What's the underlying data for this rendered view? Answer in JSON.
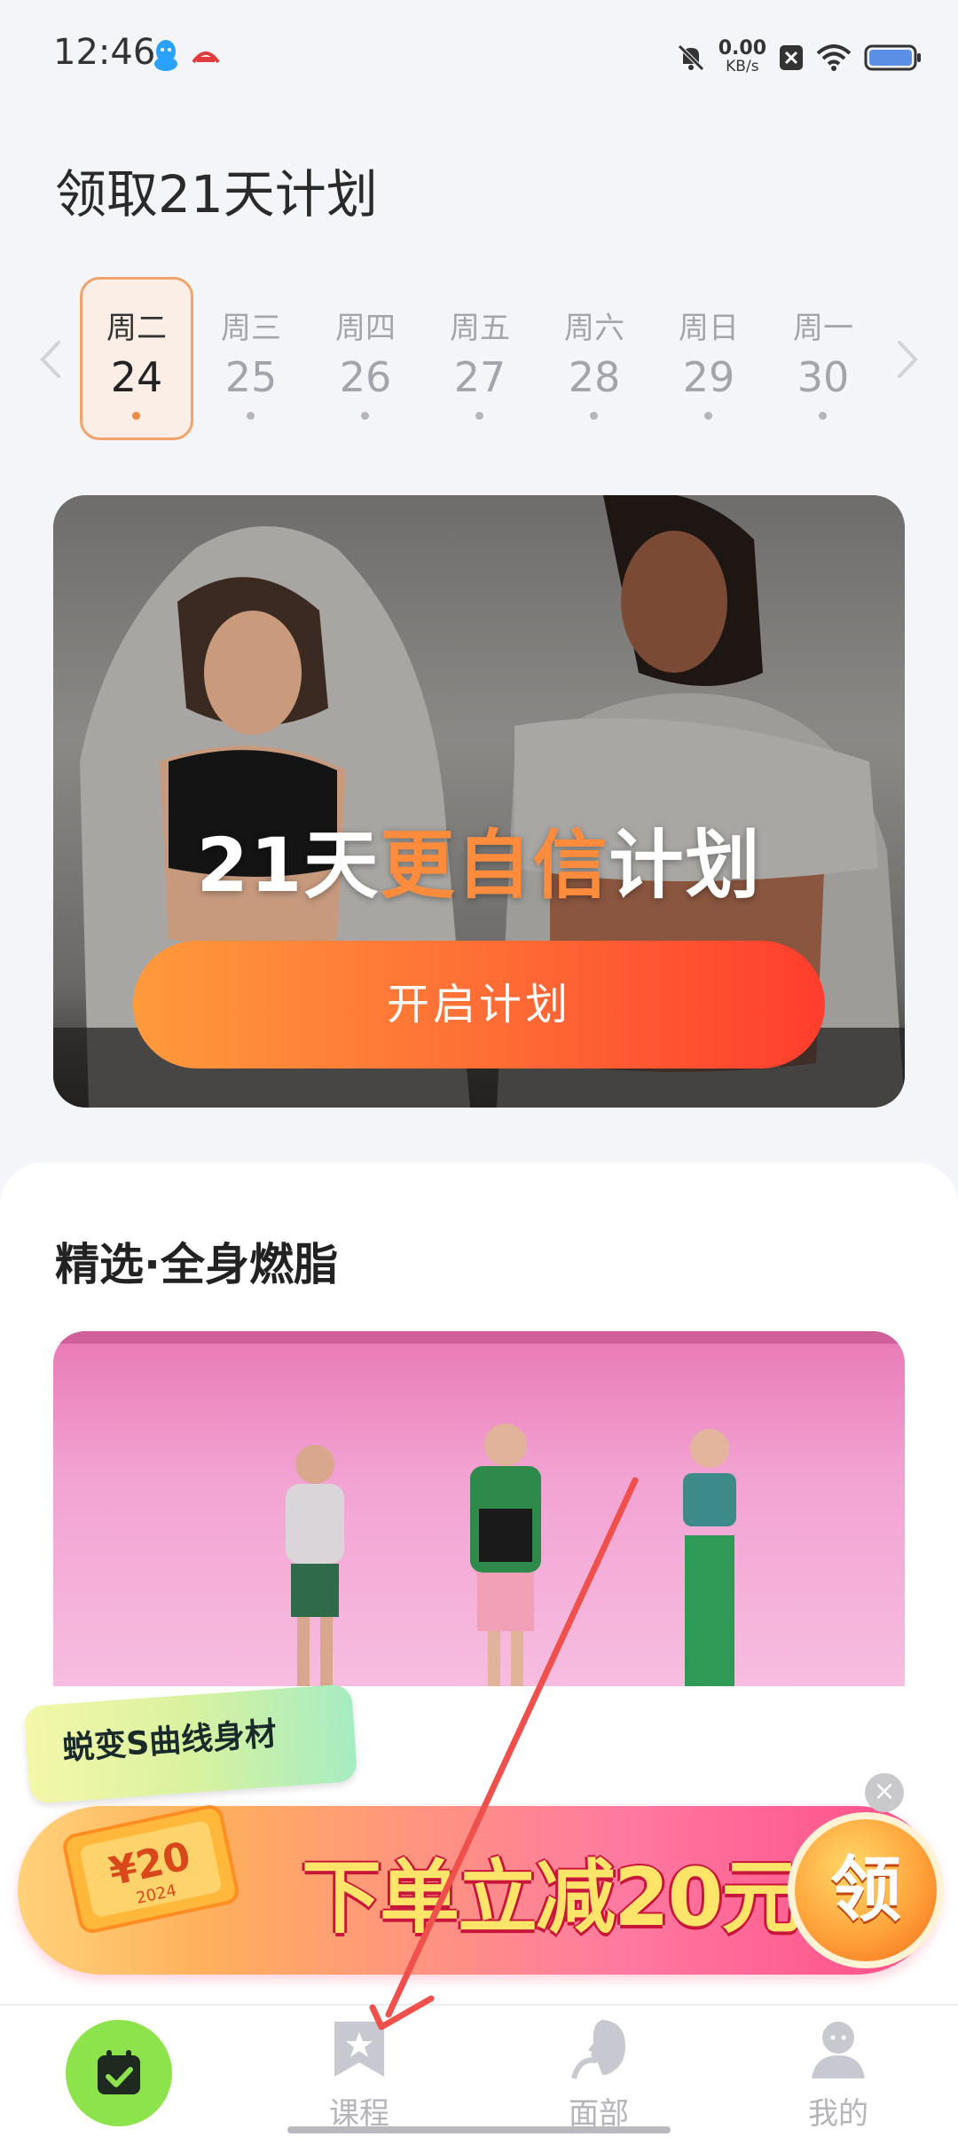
{
  "status_bar": {
    "time": "12:46",
    "net_speed_value": "0.00",
    "net_speed_unit": "KB/s",
    "icons": [
      "qq-icon",
      "app-badge-icon",
      "mute-icon",
      "close-box-icon",
      "wifi-icon",
      "battery-icon"
    ]
  },
  "page": {
    "title": "领取21天计划"
  },
  "days": [
    {
      "weekday": "周二",
      "date": "24",
      "active": true
    },
    {
      "weekday": "周三",
      "date": "25",
      "active": false
    },
    {
      "weekday": "周四",
      "date": "26",
      "active": false
    },
    {
      "weekday": "周五",
      "date": "27",
      "active": false
    },
    {
      "weekday": "周六",
      "date": "28",
      "active": false
    },
    {
      "weekday": "周日",
      "date": "29",
      "active": false
    },
    {
      "weekday": "周一",
      "date": "30",
      "active": false
    }
  ],
  "hero": {
    "title_prefix": "21天",
    "title_highlight": "更自信",
    "title_suffix": "计划",
    "button_label": "开启计划"
  },
  "section": {
    "title": "精选·全身燃脂"
  },
  "promo": {
    "tag": "蜕变S曲线身材",
    "coupon_value": "¥20",
    "coupon_year": "2024",
    "headline": "下单立减20元",
    "claim_label": "领",
    "close_label": "×"
  },
  "nav": {
    "items": [
      {
        "label": "",
        "icon": "calendar-check-icon",
        "active": true
      },
      {
        "label": "课程",
        "icon": "bookmark-star-icon",
        "active": false
      },
      {
        "label": "面部",
        "icon": "face-profile-icon",
        "active": false
      },
      {
        "label": "我的",
        "icon": "user-icon",
        "active": false
      }
    ]
  },
  "colors": {
    "accent_orange": "#ff8c3c",
    "button_gradient_start": "#ff9a3c",
    "button_gradient_end": "#ff3d2e",
    "nav_active_green": "#8de34c",
    "promo_pink": "#ff4c8a",
    "annotation_red": "#f0504c"
  }
}
